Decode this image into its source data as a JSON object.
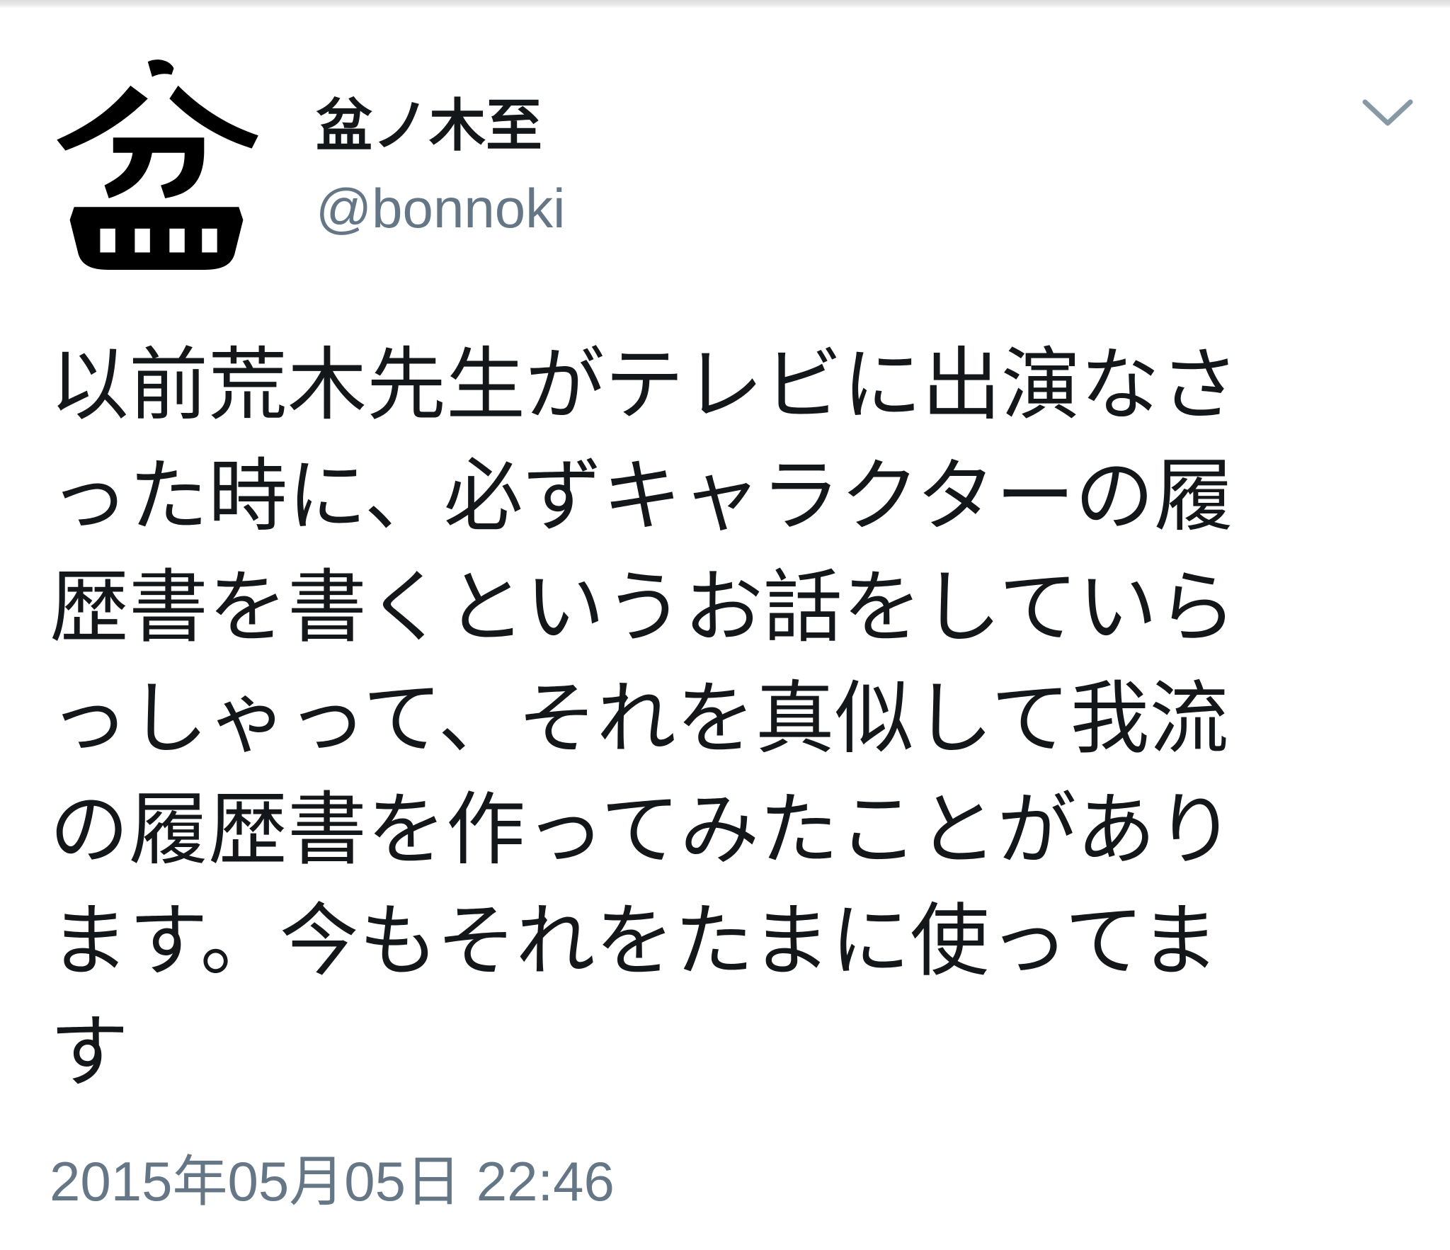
{
  "tweet": {
    "avatar_icon": "bon-kanji-avatar-icon",
    "avatar_text": "盆",
    "author": {
      "display_name": "盆ノ木至",
      "handle": "@bonnoki"
    },
    "menu_icon": "chevron-down-icon",
    "text_lines": [
      "以前荒木先生がテレビに出演なさ",
      "った時に、必ずキャラクターの履",
      "歴書を書くというお話をしていら",
      "っしゃって、それを真似して我流",
      "の履歴書を作ってみたことがあり",
      "ます。今もそれをたまに使ってま",
      "す"
    ],
    "timestamp": "2015年05月05日 22:46"
  },
  "colors": {
    "text": "#14171a",
    "secondary": "#657786",
    "background": "#ffffff"
  }
}
